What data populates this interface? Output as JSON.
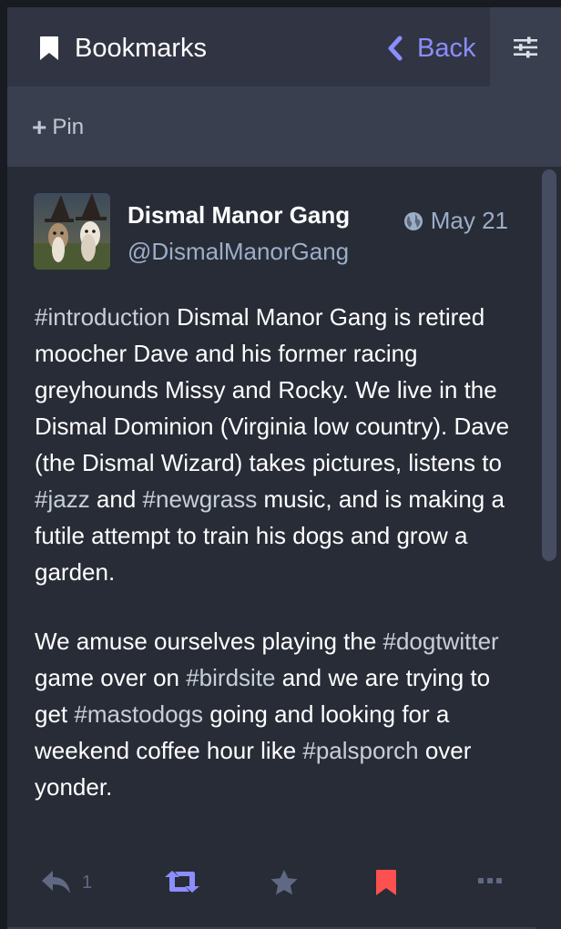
{
  "header": {
    "title": "Bookmarks",
    "back_label": "Back",
    "bookmark_icon": "bookmark-icon",
    "settings_icon": "sliders-icon"
  },
  "pinbar": {
    "pin_label": "Pin",
    "plus_glyph": "+"
  },
  "status": {
    "display_name": "Dismal Manor Gang",
    "acct": "@DismalManorGang",
    "time": "May 21",
    "visibility_icon": "globe-icon",
    "content": {
      "p1": [
        {
          "text": "#introduction",
          "tag": true
        },
        {
          "text": " Dismal Manor Gang is retired moocher Dave and his former racing greyhounds Missy and Rocky. We live in the Dismal Dominion (Virginia low country). Dave (the Dismal Wizard) takes pictures, listens to ",
          "tag": false
        },
        {
          "text": "#jazz",
          "tag": true
        },
        {
          "text": " and ",
          "tag": false
        },
        {
          "text": "#newgrass",
          "tag": true
        },
        {
          "text": " music, and is making a futile attempt to train his dogs and grow a garden.",
          "tag": false
        }
      ],
      "p2": [
        {
          "text": "We amuse ourselves playing the ",
          "tag": false
        },
        {
          "text": "#dogtwitter",
          "tag": true
        },
        {
          "text": " game over on ",
          "tag": false
        },
        {
          "text": "#birdsite",
          "tag": true
        },
        {
          "text": " and we are trying to get ",
          "tag": false
        },
        {
          "text": "#mastodogs",
          "tag": true
        },
        {
          "text": " going and looking for a weekend coffee hour like ",
          "tag": false
        },
        {
          "text": "#palsporch",
          "tag": true
        },
        {
          "text": " over yonder.",
          "tag": false
        }
      ]
    },
    "actions": {
      "reply_count": "1",
      "reply_icon": "reply-icon",
      "boost_icon": "retweet-icon",
      "favourite_icon": "star-icon",
      "bookmark_icon": "bookmark-icon",
      "more_icon": "ellipsis-icon"
    }
  },
  "colors": {
    "accent": "#8c8dff",
    "boosted": "#8c8dff",
    "bookmarked": "#ff5050",
    "muted": "#606984",
    "panel": "#282c37",
    "header": "#313543"
  }
}
